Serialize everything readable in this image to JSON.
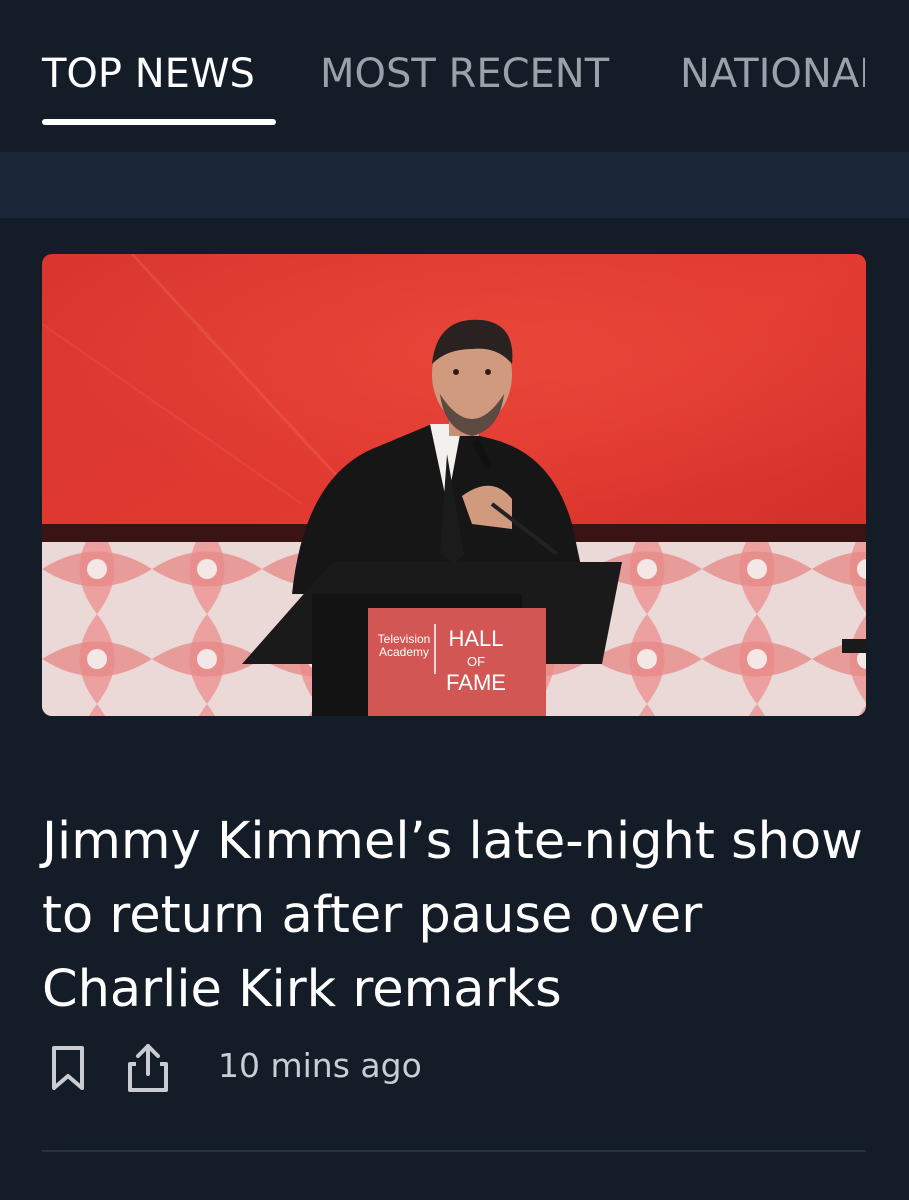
{
  "tabs": [
    {
      "label": "TOP NEWS",
      "active": true
    },
    {
      "label": "MOST RECENT",
      "active": false
    },
    {
      "label": "NATIONAL",
      "active": false
    }
  ],
  "article": {
    "image_alt": "Jimmy Kimmel speaking at a podium",
    "podium_sign": {
      "org_line1": "Television",
      "org_line2": "Academy",
      "title_line1": "HALL",
      "title_line2": "OF",
      "title_line3": "FAME"
    },
    "headline": "Jimmy Kimmel’s late-night show to return after pause over Charlie Kirk remarks",
    "timestamp": "10 mins ago"
  },
  "actions": {
    "bookmark_icon": "bookmark-icon",
    "share_icon": "share-icon"
  },
  "colors": {
    "background": "#141c27",
    "band": "#1b2738",
    "active_tab": "#ffffff",
    "inactive_tab": "#9ba1a9"
  }
}
